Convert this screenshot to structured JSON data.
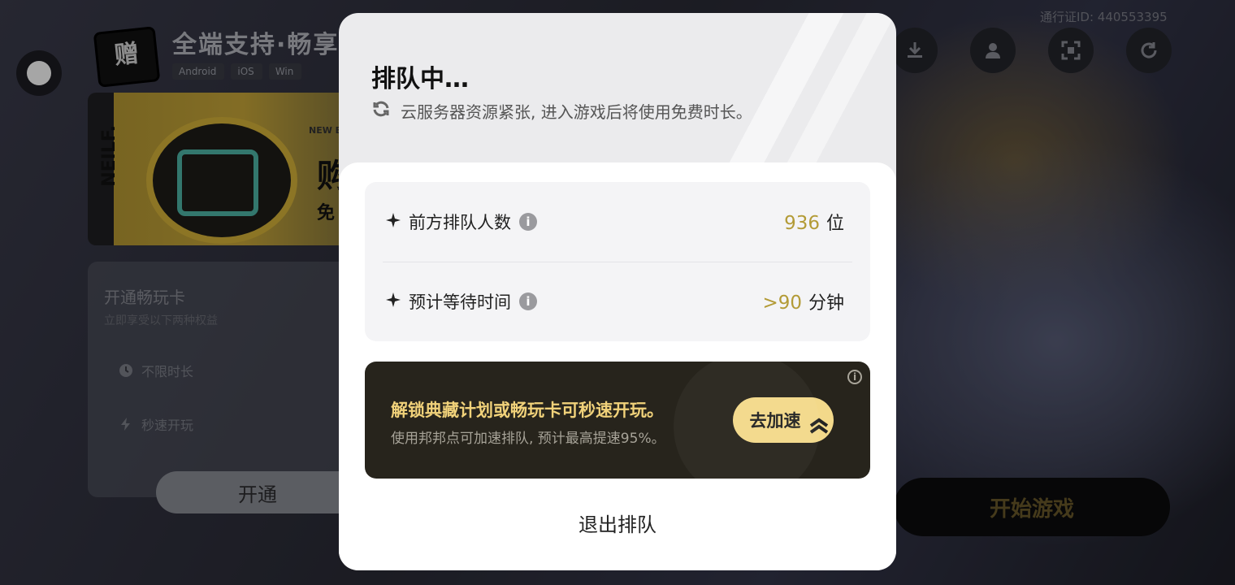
{
  "background": {
    "banner_title": "全端支持·畅享",
    "platforms": [
      "Android",
      "iOS",
      "Win"
    ],
    "promo": {
      "vertical_text": "NEILF.",
      "tag": "NEW EI",
      "big": "购",
      "sub": "免",
      "stamp": "赠"
    },
    "pass_card": {
      "title": "开通畅玩卡",
      "subtitle": "立即享受以下两种权益",
      "features": [
        "不限时长",
        "秒速开玩"
      ],
      "open_label": "开通"
    },
    "pass_id": "通行证ID: 440553395",
    "top_icons": [
      "download-icon",
      "user-icon",
      "scan-icon",
      "refresh-icon"
    ],
    "start_label": "开始游戏"
  },
  "dialog": {
    "title": "排队中…",
    "notice": "云服务器资源紧张, 进入游戏后将使用免费时长。",
    "stats": [
      {
        "label": "前方排队人数",
        "value": "936",
        "unit": "位"
      },
      {
        "label": "预计等待时间",
        "value": ">90",
        "unit": "分钟"
      }
    ],
    "boost": {
      "title": "解锁典藏计划或畅玩卡可秒速开玩。",
      "subtitle": "使用邦邦点可加速排队, 预计最高提速95%。",
      "button": "去加速"
    },
    "exit_label": "退出排队"
  },
  "colors": {
    "accent_gold": "#b39b37",
    "boost_bg": "#27241c",
    "boost_button": "#f3d98a",
    "boost_title": "#f1d27a"
  }
}
